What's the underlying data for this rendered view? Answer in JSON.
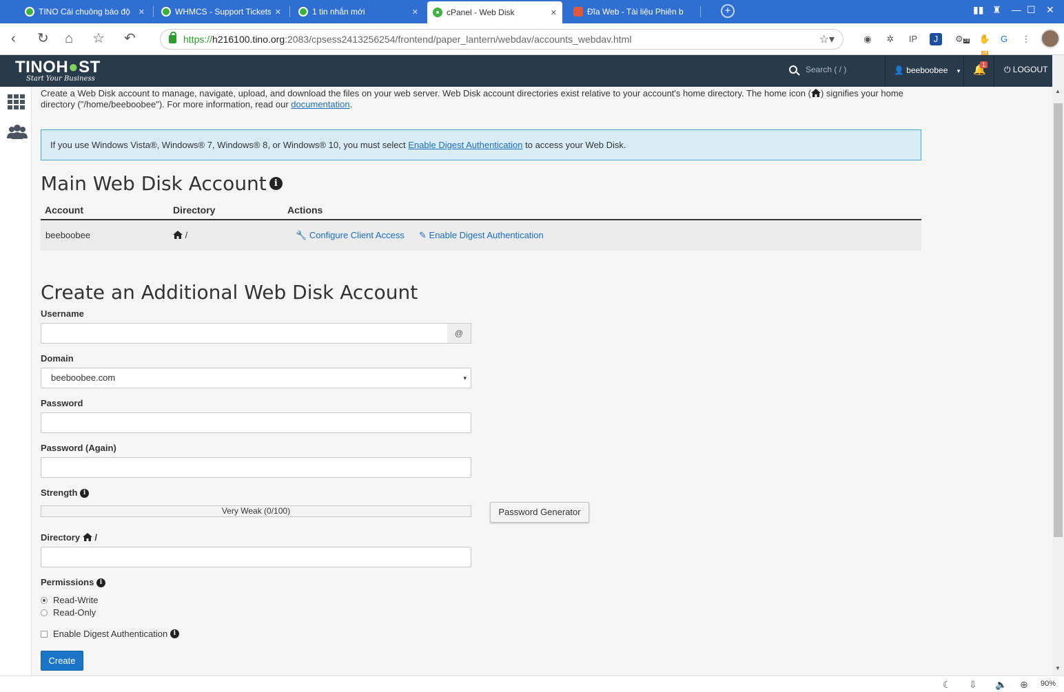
{
  "browser": {
    "tabs": [
      {
        "title": "TINO Cái chuông báo độ",
        "active": false
      },
      {
        "title": "WHMCS - Support Tickets",
        "active": false
      },
      {
        "title": "1 tin nhắn mới",
        "active": false
      },
      {
        "title": "cPanel - Web Disk",
        "active": true
      },
      {
        "title": "Đĩa Web - Tài liệu Phiên b",
        "active": false
      }
    ],
    "url": {
      "scheme": "https://",
      "host": "h216100.tino.org",
      "rest": ":2083/cpsess2413256254/frontend/paper_lantern/webdav/accounts_webdav.html"
    },
    "extension_badges": {
      "count": "28",
      "off": "off"
    },
    "zoom": "90%"
  },
  "header": {
    "logo": "TINOHOST",
    "logo_left": "TINOH",
    "logo_right": "ST",
    "tagline": "Start Your Business",
    "search_placeholder": "Search ( / )",
    "username": "beeboobee",
    "notification_count": "1",
    "logout": "LOGOUT"
  },
  "intro": {
    "text_1": "Create a Web Disk account to manage, navigate, upload, and download the files on your web server. Web Disk account directories exist relative to your account's home directory. The home icon (",
    "text_2": ") signifies your home directory (\"/home/beeboobee\"). For more information, read our ",
    "link": "documentation",
    "text_3": "."
  },
  "alert": {
    "text_1": "If you use Windows Vista®, Windows® 7, Windows® 8, or Windows® 10, you must select ",
    "link": "Enable Digest Authentication",
    "text_2": " to access your Web Disk."
  },
  "main_account": {
    "heading": "Main Web Disk Account",
    "columns": [
      "Account",
      "Directory",
      "Actions"
    ],
    "row": {
      "account": "beeboobee",
      "directory": "/",
      "actions": [
        "Configure Client Access",
        "Enable Digest Authentication"
      ]
    }
  },
  "create_form": {
    "heading": "Create an Additional Web Disk Account",
    "username_label": "Username",
    "username_value": "",
    "username_addon": "@",
    "domain_label": "Domain",
    "domain_value": "beeboobee.com",
    "password_label": "Password",
    "password_again_label": "Password (Again)",
    "strength_label": "Strength",
    "strength_text": "Very Weak (0/100)",
    "password_generator": "Password Generator",
    "directory_label": "Directory",
    "directory_suffix": "/",
    "permissions_label": "Permissions",
    "permissions": [
      {
        "label": "Read-Write",
        "selected": true
      },
      {
        "label": "Read-Only",
        "selected": false
      }
    ],
    "digest_label": "Enable Digest Authentication",
    "create_button": "Create"
  }
}
